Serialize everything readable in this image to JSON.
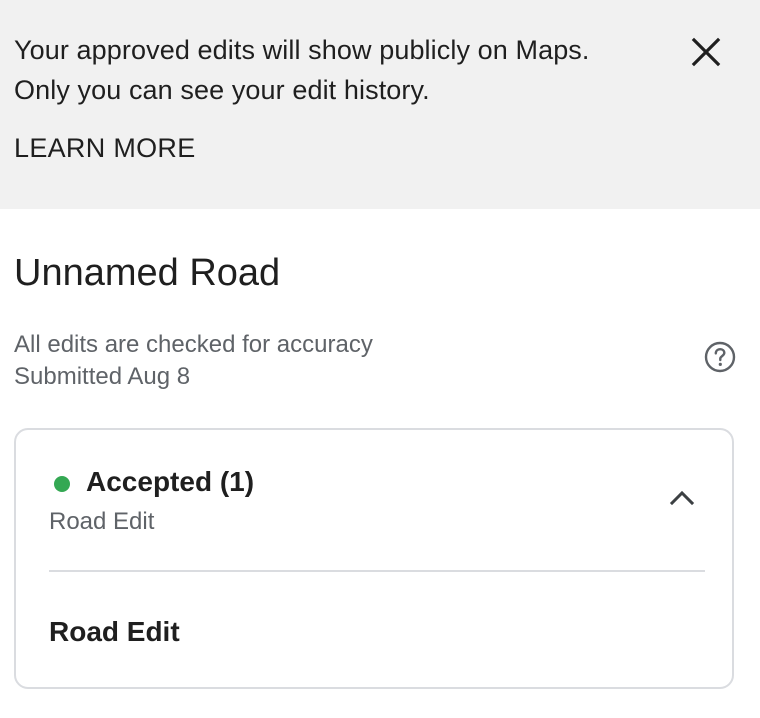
{
  "banner": {
    "line1": "Your approved edits will show publicly on Maps.",
    "line2": "Only you can see your edit history.",
    "learn_more": "LEARN MORE",
    "close_icon": "close-icon"
  },
  "place": {
    "title": "Unnamed Road",
    "accuracy_note": "All edits are checked for accuracy",
    "submitted": "Submitted Aug 8",
    "help_icon": "help-circle-icon"
  },
  "card": {
    "status_label": "Accepted (1)",
    "status_color": "#34a853",
    "status_subtitle": "Road Edit",
    "expand_icon": "chevron-up-icon",
    "detail_title": "Road Edit"
  },
  "colors": {
    "banner_bg": "#f1f1f1",
    "secondary_text": "#5f6368",
    "border": "#dadce0"
  }
}
